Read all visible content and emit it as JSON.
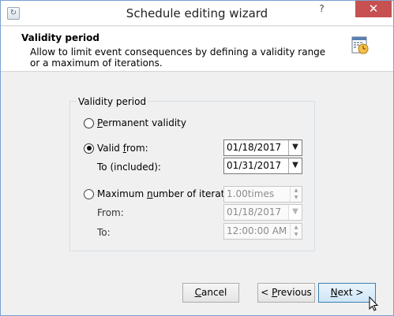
{
  "window": {
    "title": "Schedule editing wizard",
    "help_glyph": "?",
    "close_glyph": "✕"
  },
  "header": {
    "title": "Validity period",
    "description": "Allow to limit event consequences by defining a validity range or a maximum of iterations."
  },
  "group": {
    "label": "Validity period"
  },
  "options": {
    "permanent": {
      "pre": "",
      "key": "P",
      "post": "ermanent validity",
      "checked": false
    },
    "valid_from": {
      "pre": "Valid ",
      "key": "f",
      "post": "rom:",
      "checked": true
    },
    "max_iter": {
      "pre": "Maximum ",
      "key": "n",
      "post": "umber of iteration",
      "checked": false
    }
  },
  "valid_range": {
    "to_label": "To (included):",
    "from_value": "01/18/2017",
    "to_value": "01/31/2017"
  },
  "iterations": {
    "count_value": "1.00times",
    "from_label": "From:",
    "to_label": "To:",
    "from_value": "01/18/2017",
    "to_value": "12:00:00 AM"
  },
  "buttons": {
    "cancel": {
      "pre": "",
      "key": "C",
      "post": "ancel"
    },
    "previous": {
      "pre": "< ",
      "key": "P",
      "post": "revious"
    },
    "next": {
      "pre": "",
      "key": "N",
      "post": "ext >"
    }
  },
  "icons": {
    "app": "app-icon",
    "header": "calendar-clock-icon",
    "dropdown": "chevron-down-icon",
    "cursor": "mouse-pointer-icon"
  }
}
